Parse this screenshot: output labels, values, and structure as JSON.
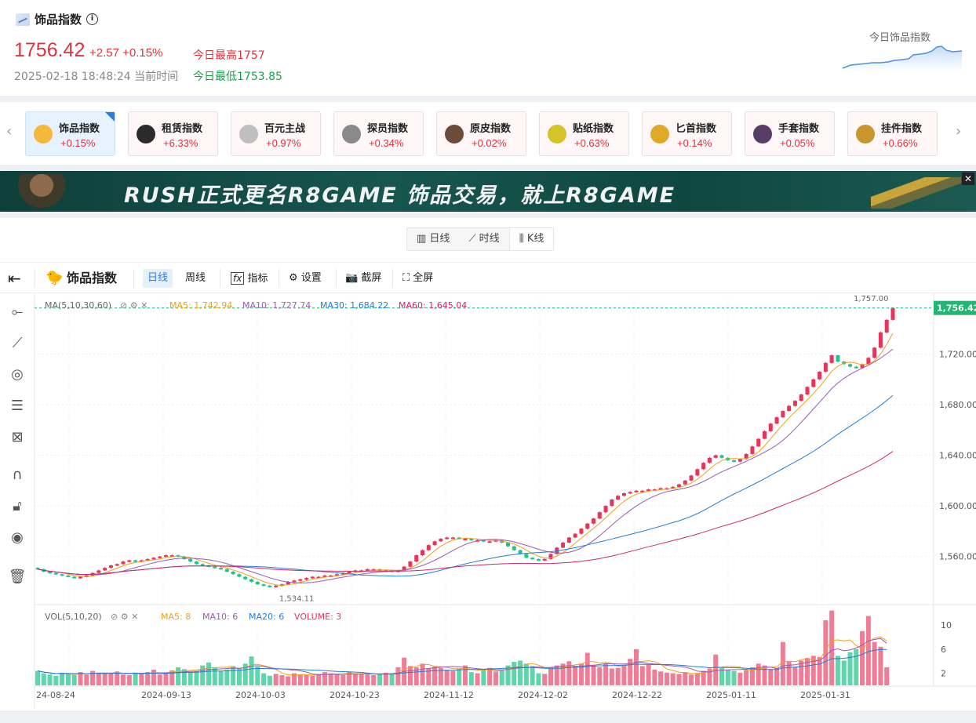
{
  "header": {
    "title": "饰品指数",
    "price": "1756.42",
    "change": "+2.57 +0.15%",
    "day_high": "今日最高1757",
    "timestamp": "2025-02-18 18:48:24 当前时间",
    "day_low": "今日最低1753.85",
    "spark_title": "今日饰品指数"
  },
  "index_tabs": [
    {
      "name": "饰品指数",
      "pct": "+0.15%",
      "color": "#f5b83d",
      "active": true
    },
    {
      "name": "租赁指数",
      "pct": "+6.33%",
      "color": "#2b2b2b",
      "active": false
    },
    {
      "name": "百元主战",
      "pct": "+0.97%",
      "color": "#bfbfbf",
      "active": false
    },
    {
      "name": "探员指数",
      "pct": "+0.34%",
      "color": "#8a8a8a",
      "active": false
    },
    {
      "name": "原皮指数",
      "pct": "+0.02%",
      "color": "#6b4b3a",
      "active": false
    },
    {
      "name": "贴纸指数",
      "pct": "+0.63%",
      "color": "#d6c22b",
      "active": false
    },
    {
      "name": "匕首指数",
      "pct": "+0.14%",
      "color": "#e0a92a",
      "active": false
    },
    {
      "name": "手套指数",
      "pct": "+0.05%",
      "color": "#5a3d66",
      "active": false
    },
    {
      "name": "挂件指数",
      "pct": "+0.66%",
      "color": "#c9952f",
      "active": false
    }
  ],
  "banner": {
    "text": "RUSH正式更名R8GAME  饰品交易，就上R8GAME",
    "close": "✕"
  },
  "view_switch": {
    "day_line": "日线",
    "time_line": "时线",
    "k_line": "K线"
  },
  "toolbar": {
    "title": "饰品指数",
    "daily": "日线",
    "weekly": "周线",
    "indicator": "指标",
    "settings": "设置",
    "screenshot": "截屏",
    "fullscreen": "全屏"
  },
  "legend": {
    "ma_label": "MA(5,10,30,60)",
    "ma5": "MA5: 1,742.94",
    "ma10": "MA10: 1,727.74",
    "ma30": "MA30: 1,684.22",
    "ma60": "MA60: 1,645.04",
    "vol_label": "VOL(5,10,20)",
    "vma5": "MA5: 8",
    "vma10": "MA10: 6",
    "vma20": "MA20: 6",
    "volume": "VOLUME: 3"
  },
  "colors": {
    "up": "#e8335a",
    "down": "#22c38e",
    "ma5": "#f0a018",
    "ma10": "#9b59b6",
    "ma30": "#1f7fd8",
    "ma60": "#d4256e",
    "last_price": "#22b573"
  },
  "chart_data": {
    "type": "candlestick",
    "price_axis": {
      "ticks": [
        1560,
        1600,
        1640,
        1680,
        1720
      ],
      "tick_labels": [
        "1,560.00",
        "1,600.00",
        "1,640.00",
        "1,680.00",
        "1,720.00"
      ],
      "range": [
        1522,
        1768
      ]
    },
    "volume_axis": {
      "ticks": [
        2,
        6,
        10
      ],
      "range": [
        0,
        13
      ]
    },
    "x_labels": [
      "2024-08-24",
      "2024-09-13",
      "2024-10-03",
      "2024-10-23",
      "2024-11-12",
      "2024-12-02",
      "2024-12-22",
      "2025-01-11",
      "2025-01-31"
    ],
    "last_price_label": "1,756.42",
    "high_label": "1,757.00",
    "low_label": "1,534.11",
    "closes": [
      1550,
      1548,
      1547,
      1546,
      1545,
      1544,
      1543,
      1544,
      1545,
      1547,
      1549,
      1551,
      1553,
      1554,
      1556,
      1557,
      1556,
      1557,
      1558,
      1559,
      1560,
      1561,
      1561,
      1560,
      1558,
      1556,
      1554,
      1553,
      1552,
      1551,
      1550,
      1548,
      1546,
      1544,
      1542,
      1540,
      1538,
      1537,
      1536,
      1537,
      1538,
      1540,
      1541,
      1542,
      1543,
      1544,
      1544,
      1545,
      1545,
      1546,
      1547,
      1548,
      1549,
      1549,
      1550,
      1550,
      1549,
      1549,
      1548,
      1549,
      1552,
      1556,
      1561,
      1565,
      1569,
      1572,
      1574,
      1575,
      1575,
      1574,
      1574,
      1573,
      1573,
      1572,
      1572,
      1573,
      1571,
      1568,
      1565,
      1562,
      1559,
      1558,
      1557,
      1558,
      1562,
      1567,
      1571,
      1575,
      1578,
      1582,
      1586,
      1590,
      1595,
      1600,
      1605,
      1608,
      1610,
      1611,
      1612,
      1612,
      1613,
      1613,
      1614,
      1614,
      1615,
      1617,
      1620,
      1624,
      1629,
      1634,
      1638,
      1640,
      1638,
      1636,
      1635,
      1637,
      1641,
      1647,
      1653,
      1659,
      1665,
      1670,
      1675,
      1679,
      1683,
      1688,
      1694,
      1700,
      1706,
      1713,
      1719,
      1714,
      1712,
      1710,
      1709,
      1712,
      1717,
      1725,
      1737,
      1747,
      1756.42
    ],
    "volumes": [
      2.4,
      2.0,
      1.8,
      1.6,
      2.1,
      1.9,
      1.7,
      2.2,
      1.8,
      2.4,
      2.1,
      1.9,
      2.0,
      2.3,
      1.8,
      1.7,
      2.1,
      1.9,
      2.2,
      2.6,
      1.8,
      2.0,
      2.5,
      3.0,
      2.7,
      2.2,
      2.4,
      3.3,
      3.8,
      3.0,
      2.4,
      2.6,
      3.2,
      2.8,
      3.6,
      4.8,
      3.1,
      2.0,
      1.6,
      1.9,
      1.7,
      1.5,
      2.0,
      1.8,
      1.7,
      1.6,
      1.9,
      2.2,
      2.0,
      1.8,
      1.7,
      2.2,
      2.0,
      1.9,
      1.8,
      1.7,
      1.9,
      2.1,
      2.0,
      3.0,
      4.6,
      3.2,
      3.0,
      3.6,
      2.8,
      3.1,
      2.9,
      2.6,
      2.4,
      2.8,
      3.3,
      2.2,
      2.0,
      2.6,
      2.9,
      2.3,
      2.5,
      3.3,
      3.9,
      4.1,
      3.6,
      3.2,
      2.0,
      1.9,
      3.0,
      3.3,
      3.6,
      4.0,
      3.2,
      3.6,
      5.4,
      3.4,
      3.0,
      3.6,
      2.8,
      2.9,
      3.4,
      4.4,
      6.0,
      3.2,
      3.4,
      2.6,
      2.3,
      2.1,
      2.0,
      1.9,
      2.2,
      1.8,
      2.0,
      2.4,
      2.8,
      5.1,
      2.9,
      2.6,
      2.4,
      2.1,
      2.5,
      3.0,
      3.6,
      3.3,
      2.7,
      2.9,
      7.2,
      3.9,
      3.0,
      4.1,
      4.5,
      4.9,
      4.7,
      10.8,
      12.4,
      4.9,
      4.1,
      5.5,
      6.0,
      9.0,
      11.5,
      7.2,
      6.4,
      3.0
    ],
    "ma5": [
      1744,
      1742.94
    ],
    "ma10": [
      1727.74
    ],
    "ma30": [
      1684.22
    ],
    "ma60": [
      1645.04
    ]
  }
}
